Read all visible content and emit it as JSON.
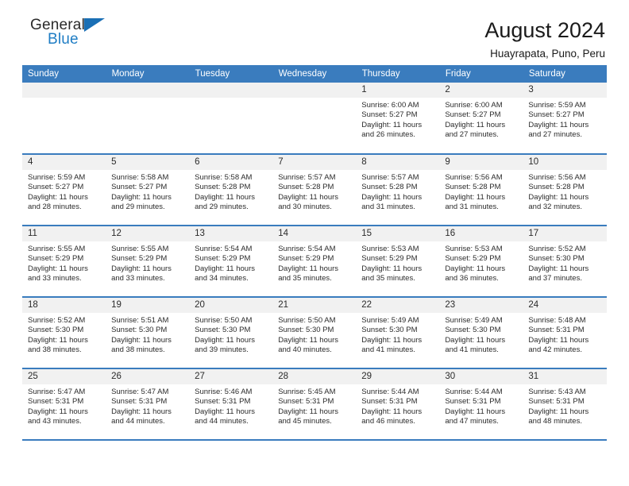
{
  "brand": {
    "name_part1": "General",
    "name_part2": "Blue",
    "flag_icon": "triangle-flag-icon"
  },
  "header": {
    "title": "August 2024",
    "location": "Huayrapata, Puno, Peru"
  },
  "weekdays": [
    "Sunday",
    "Monday",
    "Tuesday",
    "Wednesday",
    "Thursday",
    "Friday",
    "Saturday"
  ],
  "labels": {
    "sunrise": "Sunrise:",
    "sunset": "Sunset:",
    "daylight": "Daylight:"
  },
  "colors": {
    "header_blue": "#3a7cbe",
    "brand_blue": "#1f7dc4",
    "daynum_band": "#f1f1f1",
    "text": "#2b2b2b"
  },
  "weeks": [
    [
      {
        "day": "",
        "empty": true
      },
      {
        "day": "",
        "empty": true
      },
      {
        "day": "",
        "empty": true
      },
      {
        "day": "",
        "empty": true
      },
      {
        "day": "1",
        "sunrise": "Sunrise: 6:00 AM",
        "sunset": "Sunset: 5:27 PM",
        "daylight_line1": "Daylight: 11 hours",
        "daylight_line2": "and 26 minutes."
      },
      {
        "day": "2",
        "sunrise": "Sunrise: 6:00 AM",
        "sunset": "Sunset: 5:27 PM",
        "daylight_line1": "Daylight: 11 hours",
        "daylight_line2": "and 27 minutes."
      },
      {
        "day": "3",
        "sunrise": "Sunrise: 5:59 AM",
        "sunset": "Sunset: 5:27 PM",
        "daylight_line1": "Daylight: 11 hours",
        "daylight_line2": "and 27 minutes."
      }
    ],
    [
      {
        "day": "4",
        "sunrise": "Sunrise: 5:59 AM",
        "sunset": "Sunset: 5:27 PM",
        "daylight_line1": "Daylight: 11 hours",
        "daylight_line2": "and 28 minutes."
      },
      {
        "day": "5",
        "sunrise": "Sunrise: 5:58 AM",
        "sunset": "Sunset: 5:27 PM",
        "daylight_line1": "Daylight: 11 hours",
        "daylight_line2": "and 29 minutes."
      },
      {
        "day": "6",
        "sunrise": "Sunrise: 5:58 AM",
        "sunset": "Sunset: 5:28 PM",
        "daylight_line1": "Daylight: 11 hours",
        "daylight_line2": "and 29 minutes."
      },
      {
        "day": "7",
        "sunrise": "Sunrise: 5:57 AM",
        "sunset": "Sunset: 5:28 PM",
        "daylight_line1": "Daylight: 11 hours",
        "daylight_line2": "and 30 minutes."
      },
      {
        "day": "8",
        "sunrise": "Sunrise: 5:57 AM",
        "sunset": "Sunset: 5:28 PM",
        "daylight_line1": "Daylight: 11 hours",
        "daylight_line2": "and 31 minutes."
      },
      {
        "day": "9",
        "sunrise": "Sunrise: 5:56 AM",
        "sunset": "Sunset: 5:28 PM",
        "daylight_line1": "Daylight: 11 hours",
        "daylight_line2": "and 31 minutes."
      },
      {
        "day": "10",
        "sunrise": "Sunrise: 5:56 AM",
        "sunset": "Sunset: 5:28 PM",
        "daylight_line1": "Daylight: 11 hours",
        "daylight_line2": "and 32 minutes."
      }
    ],
    [
      {
        "day": "11",
        "sunrise": "Sunrise: 5:55 AM",
        "sunset": "Sunset: 5:29 PM",
        "daylight_line1": "Daylight: 11 hours",
        "daylight_line2": "and 33 minutes."
      },
      {
        "day": "12",
        "sunrise": "Sunrise: 5:55 AM",
        "sunset": "Sunset: 5:29 PM",
        "daylight_line1": "Daylight: 11 hours",
        "daylight_line2": "and 33 minutes."
      },
      {
        "day": "13",
        "sunrise": "Sunrise: 5:54 AM",
        "sunset": "Sunset: 5:29 PM",
        "daylight_line1": "Daylight: 11 hours",
        "daylight_line2": "and 34 minutes."
      },
      {
        "day": "14",
        "sunrise": "Sunrise: 5:54 AM",
        "sunset": "Sunset: 5:29 PM",
        "daylight_line1": "Daylight: 11 hours",
        "daylight_line2": "and 35 minutes."
      },
      {
        "day": "15",
        "sunrise": "Sunrise: 5:53 AM",
        "sunset": "Sunset: 5:29 PM",
        "daylight_line1": "Daylight: 11 hours",
        "daylight_line2": "and 35 minutes."
      },
      {
        "day": "16",
        "sunrise": "Sunrise: 5:53 AM",
        "sunset": "Sunset: 5:29 PM",
        "daylight_line1": "Daylight: 11 hours",
        "daylight_line2": "and 36 minutes."
      },
      {
        "day": "17",
        "sunrise": "Sunrise: 5:52 AM",
        "sunset": "Sunset: 5:30 PM",
        "daylight_line1": "Daylight: 11 hours",
        "daylight_line2": "and 37 minutes."
      }
    ],
    [
      {
        "day": "18",
        "sunrise": "Sunrise: 5:52 AM",
        "sunset": "Sunset: 5:30 PM",
        "daylight_line1": "Daylight: 11 hours",
        "daylight_line2": "and 38 minutes."
      },
      {
        "day": "19",
        "sunrise": "Sunrise: 5:51 AM",
        "sunset": "Sunset: 5:30 PM",
        "daylight_line1": "Daylight: 11 hours",
        "daylight_line2": "and 38 minutes."
      },
      {
        "day": "20",
        "sunrise": "Sunrise: 5:50 AM",
        "sunset": "Sunset: 5:30 PM",
        "daylight_line1": "Daylight: 11 hours",
        "daylight_line2": "and 39 minutes."
      },
      {
        "day": "21",
        "sunrise": "Sunrise: 5:50 AM",
        "sunset": "Sunset: 5:30 PM",
        "daylight_line1": "Daylight: 11 hours",
        "daylight_line2": "and 40 minutes."
      },
      {
        "day": "22",
        "sunrise": "Sunrise: 5:49 AM",
        "sunset": "Sunset: 5:30 PM",
        "daylight_line1": "Daylight: 11 hours",
        "daylight_line2": "and 41 minutes."
      },
      {
        "day": "23",
        "sunrise": "Sunrise: 5:49 AM",
        "sunset": "Sunset: 5:30 PM",
        "daylight_line1": "Daylight: 11 hours",
        "daylight_line2": "and 41 minutes."
      },
      {
        "day": "24",
        "sunrise": "Sunrise: 5:48 AM",
        "sunset": "Sunset: 5:31 PM",
        "daylight_line1": "Daylight: 11 hours",
        "daylight_line2": "and 42 minutes."
      }
    ],
    [
      {
        "day": "25",
        "sunrise": "Sunrise: 5:47 AM",
        "sunset": "Sunset: 5:31 PM",
        "daylight_line1": "Daylight: 11 hours",
        "daylight_line2": "and 43 minutes."
      },
      {
        "day": "26",
        "sunrise": "Sunrise: 5:47 AM",
        "sunset": "Sunset: 5:31 PM",
        "daylight_line1": "Daylight: 11 hours",
        "daylight_line2": "and 44 minutes."
      },
      {
        "day": "27",
        "sunrise": "Sunrise: 5:46 AM",
        "sunset": "Sunset: 5:31 PM",
        "daylight_line1": "Daylight: 11 hours",
        "daylight_line2": "and 44 minutes."
      },
      {
        "day": "28",
        "sunrise": "Sunrise: 5:45 AM",
        "sunset": "Sunset: 5:31 PM",
        "daylight_line1": "Daylight: 11 hours",
        "daylight_line2": "and 45 minutes."
      },
      {
        "day": "29",
        "sunrise": "Sunrise: 5:44 AM",
        "sunset": "Sunset: 5:31 PM",
        "daylight_line1": "Daylight: 11 hours",
        "daylight_line2": "and 46 minutes."
      },
      {
        "day": "30",
        "sunrise": "Sunrise: 5:44 AM",
        "sunset": "Sunset: 5:31 PM",
        "daylight_line1": "Daylight: 11 hours",
        "daylight_line2": "and 47 minutes."
      },
      {
        "day": "31",
        "sunrise": "Sunrise: 5:43 AM",
        "sunset": "Sunset: 5:31 PM",
        "daylight_line1": "Daylight: 11 hours",
        "daylight_line2": "and 48 minutes."
      }
    ]
  ]
}
